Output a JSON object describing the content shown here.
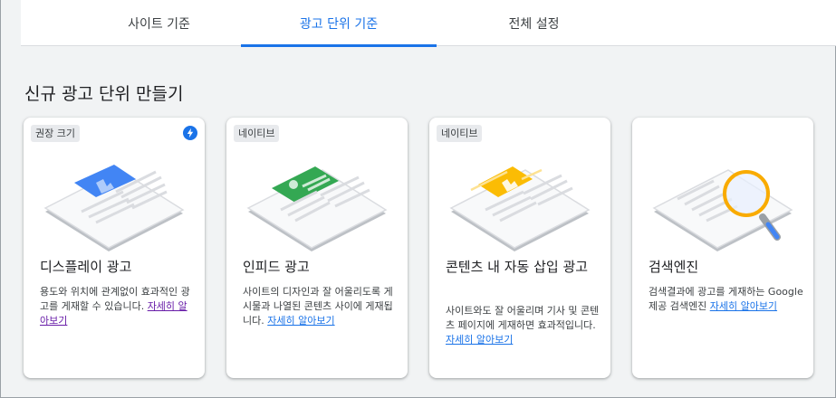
{
  "tabs": [
    {
      "label": "사이트 기준",
      "active": false
    },
    {
      "label": "광고 단위 기준",
      "active": true
    },
    {
      "label": "전체 설정",
      "active": false
    }
  ],
  "section_title": "신규 광고 단위 만들기",
  "cards": [
    {
      "chip": "권장 크기",
      "badge_icon": "lightning-bolt-icon",
      "illustration": "display-ad-illustration",
      "title": "디스플레이 광고",
      "desc": "용도와 위치에 관계없이 효과적인 광고를 게재할 수 있습니다.",
      "link": "자세히 알아보기"
    },
    {
      "chip": "네이티브",
      "illustration": "in-feed-ad-illustration",
      "title": "인피드 광고",
      "desc": "사이트의 디자인과 잘 어울리도록 게시물과 나열된 콘텐츠 사이에 게재됩니다.",
      "link": "자세히 알아보기"
    },
    {
      "chip": "네이티브",
      "illustration": "in-article-ad-illustration",
      "title": "콘텐츠 내 자동 삽입 광고",
      "desc": "사이트와도 잘 어울리며 기사 및 콘텐츠 페이지에 게재하면 효과적입니다.",
      "link": "자세히 알아보기"
    },
    {
      "illustration": "search-engine-illustration",
      "title": "검색엔진",
      "desc": "검색결과에 광고를 게재하는 Google 제공 검색엔진",
      "link": "자세히 알아보기"
    }
  ],
  "colors": {
    "accent": "#1a73e8",
    "display_blue": "#4285f4",
    "infeed_green": "#34a853",
    "inarticle_yellow": "#fbbc04",
    "search_yellow": "#f9ab00"
  }
}
